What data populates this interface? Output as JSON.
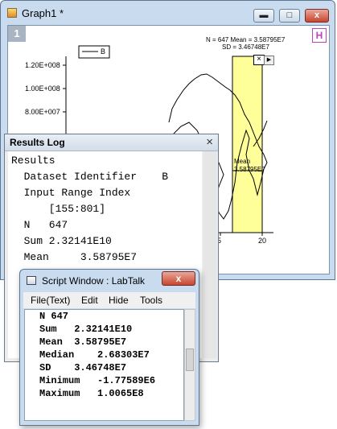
{
  "graph": {
    "title": "Graph1 *",
    "layer_label": "1",
    "h_badge": "H",
    "legend_label": "B",
    "y_ticks": [
      "1.20E+008",
      "1.00E+008",
      "8.00E+007"
    ],
    "x_ticks": [
      "5",
      "20"
    ],
    "stats_line1": "N = 647 Mean = 3.58795E7",
    "stats_line2": "SD = 3.46748E7",
    "mean_label": "Mean",
    "mean_value": "3.58795E7",
    "highlight_color": "#ffff99"
  },
  "results_log": {
    "title": "Results Log",
    "close_glyph": "×",
    "lines": [
      "Results",
      "  Dataset Identifier    B",
      "  Input Range Index",
      "      [155:801]",
      "  N   647",
      "  Sum 2.32141E10",
      "  Mean     3.58795E7"
    ]
  },
  "script_window": {
    "title": "Script Window : LabTalk",
    "close_glyph": "x",
    "menu": [
      "File(Text)",
      "Edit",
      "Hide",
      "Tools"
    ],
    "lines": [
      "N 647",
      "Sum   2.32141E10",
      "Mean  3.58795E7",
      "Median    2.68303E7",
      "SD    3.46748E7",
      "Minimum   -1.77589E6",
      "Maximum   1.0065E8"
    ]
  }
}
